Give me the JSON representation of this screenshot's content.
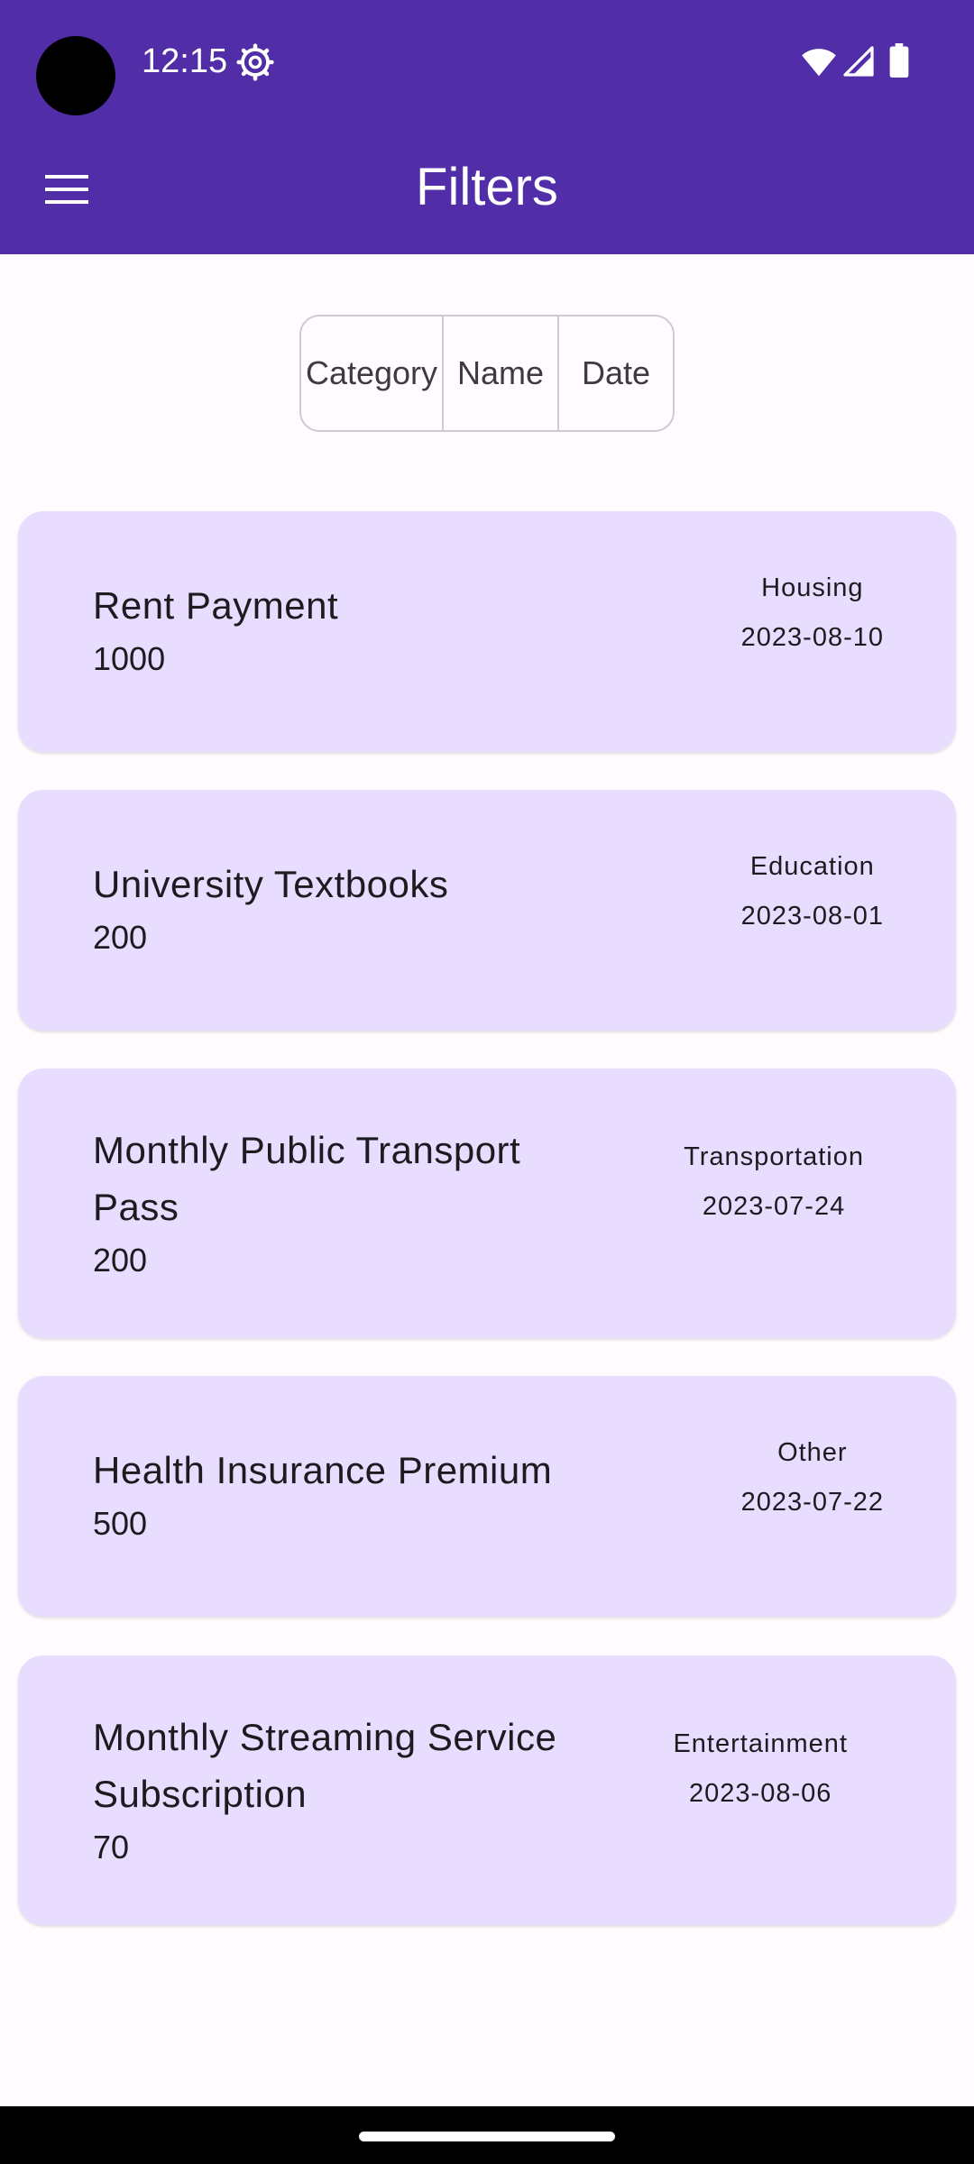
{
  "status_bar": {
    "time": "12:15"
  },
  "app_bar": {
    "title": "Filters",
    "menu_icon": "hamburger-menu-icon",
    "background_color": "#512da8"
  },
  "sort_options": {
    "items": [
      {
        "label": "Category"
      },
      {
        "label": "Name"
      },
      {
        "label": "Date"
      }
    ]
  },
  "expenses": [
    {
      "name": "Rent Payment",
      "amount": "1000",
      "category": "Housing",
      "date": "2023-08-10"
    },
    {
      "name": "University Textbooks",
      "amount": "200",
      "category": "Education",
      "date": "2023-08-01"
    },
    {
      "name": "Monthly Public Transport Pass",
      "amount": "200",
      "category": "Transportation",
      "date": "2023-07-24"
    },
    {
      "name": "Health Insurance Premium",
      "amount": "500",
      "category": "Other",
      "date": "2023-07-22"
    },
    {
      "name": "Monthly Streaming Service Subscription",
      "amount": "70",
      "category": "Entertainment",
      "date": "2023-08-06"
    }
  ],
  "colors": {
    "card_background": "#e8ddff",
    "page_background": "#fffbfe"
  }
}
